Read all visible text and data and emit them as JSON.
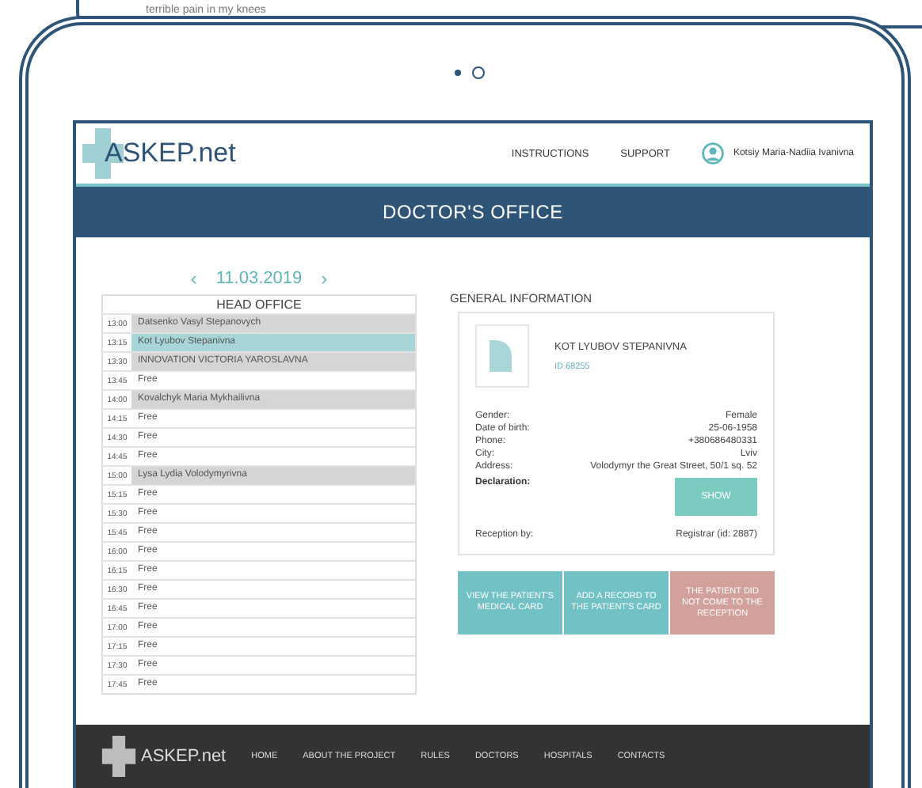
{
  "background_card": {
    "text": "terrible pain in my knees"
  },
  "header": {
    "logo": "ASKEP.net",
    "nav": [
      "INSTRUCTIONS",
      "SUPPORT"
    ],
    "user": "Kotsiy Maria-Nadiia Ivanivna"
  },
  "page_title": "DOCTOR'S OFFICE",
  "schedule": {
    "prev": "‹",
    "date": "11.03.2019",
    "next": "›",
    "title": "HEAD OFFICE",
    "rows": [
      {
        "time": "13:00",
        "name": "Datsenko Vasyl Stepanovych",
        "kind": "booked",
        "selected": false
      },
      {
        "time": "13:15",
        "name": "Kot Lyubov Stepanivna",
        "kind": "booked",
        "selected": true
      },
      {
        "time": "13:30",
        "name": "INNOVATION VICTORIA YAROSLAVNA",
        "kind": "booked",
        "selected": false
      },
      {
        "time": "13:45",
        "name": "Free",
        "kind": "free",
        "selected": false
      },
      {
        "time": "14:00",
        "name": "Kovalchyk Maria Mykhailivna",
        "kind": "booked",
        "selected": false
      },
      {
        "time": "14:15",
        "name": "Free",
        "kind": "free",
        "selected": false
      },
      {
        "time": "14:30",
        "name": "Free",
        "kind": "free",
        "selected": false
      },
      {
        "time": "14:45",
        "name": "Free",
        "kind": "free",
        "selected": false
      },
      {
        "time": "15:00",
        "name": "Lysa Lydia Volodymyrivna",
        "kind": "booked",
        "selected": false
      },
      {
        "time": "15:15",
        "name": "Free",
        "kind": "free",
        "selected": false
      },
      {
        "time": "15:30",
        "name": "Free",
        "kind": "free",
        "selected": false
      },
      {
        "time": "15:45",
        "name": "Free",
        "kind": "free",
        "selected": false
      },
      {
        "time": "16:00",
        "name": "Free",
        "kind": "free",
        "selected": false
      },
      {
        "time": "16:15",
        "name": "Free",
        "kind": "free",
        "selected": false
      },
      {
        "time": "16:30",
        "name": "Free",
        "kind": "free",
        "selected": false
      },
      {
        "time": "16:45",
        "name": "Free",
        "kind": "free",
        "selected": false
      },
      {
        "time": "17:00",
        "name": "Free",
        "kind": "free",
        "selected": false
      },
      {
        "time": "17:15",
        "name": "Free",
        "kind": "free",
        "selected": false
      },
      {
        "time": "17:30",
        "name": "Free",
        "kind": "free",
        "selected": false
      },
      {
        "time": "17:45",
        "name": "Free",
        "kind": "free",
        "selected": false
      }
    ]
  },
  "general_information": {
    "title": "GENERAL INFORMATION",
    "patient_name": "KOT LYUBOV STEPANIVNA",
    "patient_id": "ID 68255",
    "fields": [
      {
        "label": "Gender:",
        "value": "Female"
      },
      {
        "label": "Date of birth:",
        "value": "25-06-1958"
      },
      {
        "label": "Phone:",
        "value": "+380686480331"
      },
      {
        "label": "City:",
        "value": "Lviv"
      },
      {
        "label": "Address:",
        "value": "Volodymyr the Great Street, 50/1 sq. 52"
      }
    ],
    "declaration_label": "Declaration:",
    "declaration_button": "SHOW",
    "reception_label": "Reception by:",
    "reception_value": "Registrar (id: 2887)"
  },
  "actions": [
    {
      "label": "VIEW THE PATIENT'S MEDICAL CARD",
      "kind": "primary"
    },
    {
      "label": "ADD A RECORD TO THE PATIENT'S CARD",
      "kind": "primary"
    },
    {
      "label": "THE PATIENT DID NOT COME TO THE RECEPTION",
      "kind": "danger"
    }
  ],
  "footer": {
    "logo": "ASKEP.net",
    "links": [
      "HOME",
      "ABOUT THE PROJECT",
      "RULES",
      "DOCTORS",
      "HOSPITALS",
      "CONTACTS"
    ]
  }
}
